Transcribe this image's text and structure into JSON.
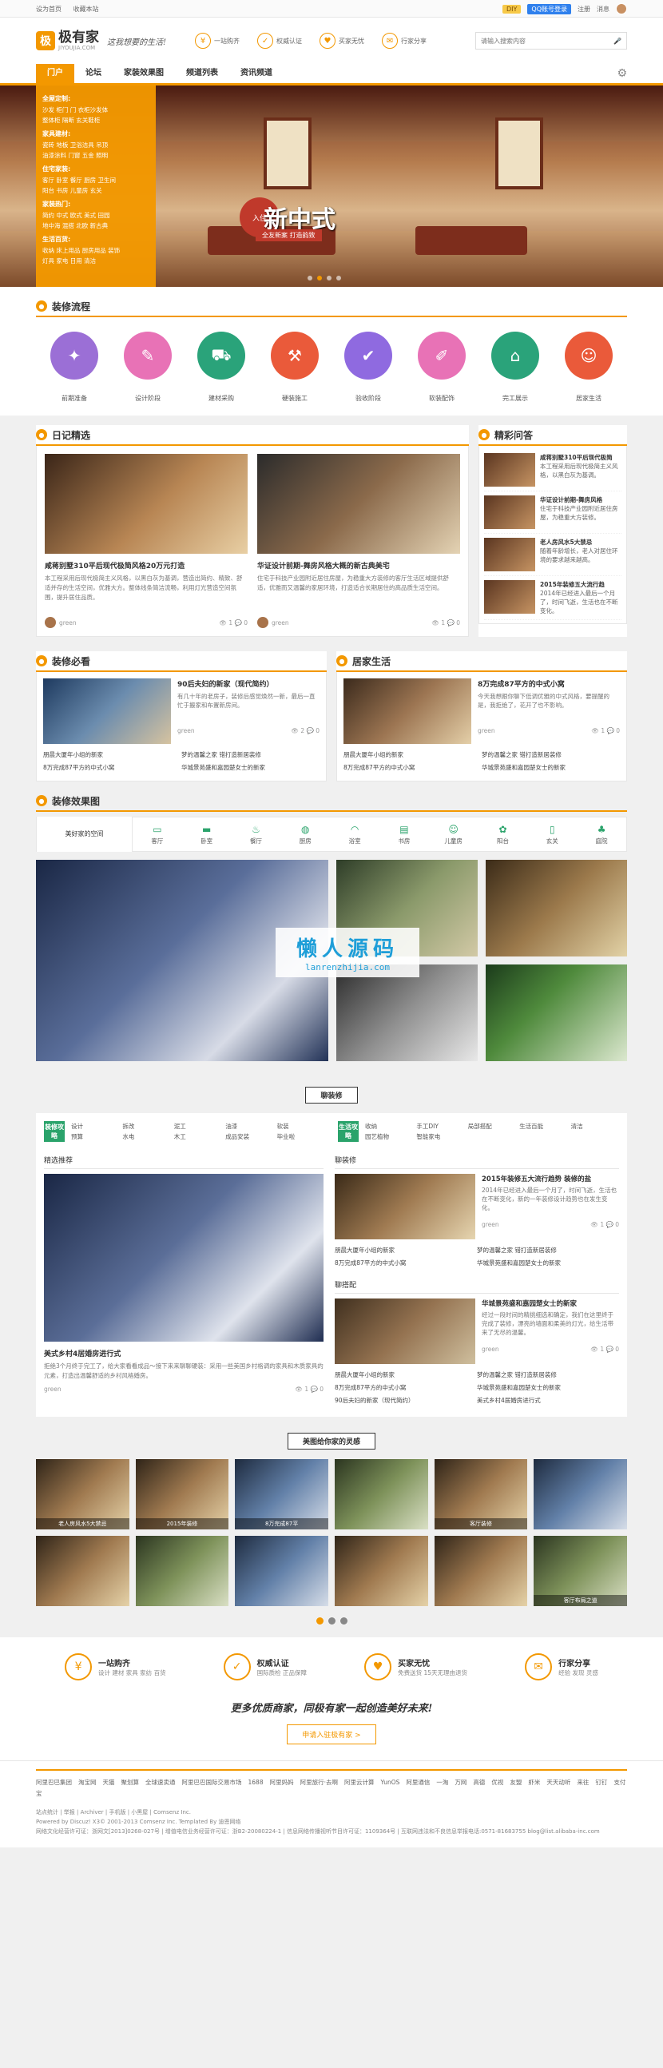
{
  "topbar": {
    "links": [
      "设为首页",
      "收藏本站"
    ],
    "diy": "DIY",
    "qq": "QQ账号登录",
    "register": "注册",
    "messages": "消息"
  },
  "header": {
    "logo_mark": "极",
    "logo_name": "极有家",
    "logo_sub": "JIYOUJIA.COM",
    "slogan": "这我想要的生活!",
    "features": [
      {
        "icon": "cart-icon",
        "glyph": "¥",
        "label": "一站购齐"
      },
      {
        "icon": "auth-icon",
        "glyph": "✓",
        "label": "权威认证"
      },
      {
        "icon": "worry-free-icon",
        "glyph": "♥",
        "label": "买家无忧"
      },
      {
        "icon": "share-icon",
        "glyph": "✉",
        "label": "行家分享"
      }
    ],
    "search_placeholder": "请输入搜索内容"
  },
  "nav": {
    "items": [
      "门户",
      "论坛",
      "家装效果图",
      "频道列表",
      "资讯频道"
    ]
  },
  "catmenu": {
    "groups": [
      {
        "title": "全屋定制:",
        "rows": [
          "沙发 柜门 门 衣柜沙发体",
          "整体柜 隔断 玄关鞋柜"
        ]
      },
      {
        "title": "家具建材:",
        "rows": [
          "瓷砖 地板 卫浴洁具 吊顶",
          "油漆涂料 门窗 五金 照明"
        ]
      },
      {
        "title": "住宅家装:",
        "rows": [
          "客厅 卧室 餐厅 厨房 卫生间",
          "阳台 书房 儿童房 玄关"
        ]
      },
      {
        "title": "家装热门:",
        "rows": [
          "简约 中式 欧式 美式 田园",
          "地中海 混搭 北欧 新古典"
        ]
      },
      {
        "title": "生活百货:",
        "rows": [
          "收纳 床上用品 厨房用品 装饰",
          "灯具 家电 日用 清洁"
        ]
      }
    ]
  },
  "banner": {
    "seal": "入住",
    "title": "新中式",
    "subtitle": "全友新案 打造韵致"
  },
  "flow": {
    "title": "装修流程",
    "steps": [
      {
        "label": "前期准备",
        "color": "#9b6fd6",
        "icon": "bulb-icon",
        "glyph": "✦"
      },
      {
        "label": "设计阶段",
        "color": "#e872b6",
        "icon": "pencil-icon",
        "glyph": "✎"
      },
      {
        "label": "建材采购",
        "color": "#2aa37a",
        "icon": "truck-icon",
        "glyph": "⛟"
      },
      {
        "label": "硬装施工",
        "color": "#ea5a3a",
        "icon": "hammer-icon",
        "glyph": "⚒"
      },
      {
        "label": "验收阶段",
        "color": "#8f6ae0",
        "icon": "check-icon",
        "glyph": "✔"
      },
      {
        "label": "软装配饰",
        "color": "#e872b6",
        "icon": "brush-icon",
        "glyph": "✐"
      },
      {
        "label": "完工展示",
        "color": "#2aa37a",
        "icon": "home-icon",
        "glyph": "⌂"
      },
      {
        "label": "居家生活",
        "color": "#ea5a3a",
        "icon": "smile-icon",
        "glyph": "☺"
      }
    ]
  },
  "diary": {
    "title": "日记精选",
    "cards": [
      {
        "title": "咸蒋别墅310平后现代极简风格20万元打造",
        "desc": "本工程采用后现代极简主义风格，以黑白灰为基调，营造出简约、精致、舒适并存的生活空间，优雅大方。整体线条简洁流畅，利用灯光营造空间氛围，提升居住品质。",
        "user": "green",
        "views": "1",
        "comments": "0"
      },
      {
        "title": "华证设计前期-舞房风格大概的新古典美宅",
        "desc": "住宅于科技产业园附近居住房屋，为稳重大方装修的客厅生活区域提供舒适，优雅而又温馨的家居环境，打造适合长期居住的高品质生活空间。",
        "user": "green",
        "views": "1",
        "comments": "0"
      }
    ]
  },
  "qa": {
    "title": "精彩问答",
    "items": [
      {
        "title": "咸蒋别墅310平后现代极简",
        "desc": "本工程采用后现代极简主义风格，以黑白灰为基调。"
      },
      {
        "title": "华证设计前期-舞房风格",
        "desc": "住宅于科技产业园附近居住房屋，为稳重大方装修。"
      },
      {
        "title": "老人房风水5大禁忌",
        "desc": "随着年龄增长，老人对居住环境的要求越来越高。"
      },
      {
        "title": "2015年装修五大流行趋",
        "desc": "2014年已经进入最后一个月了，时间飞逝，生活也在不断变化。"
      }
    ]
  },
  "must": {
    "title": "装修必看",
    "feature": {
      "title": "90后夫妇的新家（现代简约）",
      "desc": "有几十年的老房子，装修后感觉焕然一新，最后一直忙于搬家和布置新房间。",
      "user": "green",
      "views": "2",
      "comments": "0"
    },
    "links": [
      "朋晨大厦年小组的新家",
      "梦的温馨之家 错打造新居装修",
      "8万完成87平方的中式小窝",
      "华城景苑盛和嘉园楚女士的新家"
    ]
  },
  "life": {
    "title": "居家生活",
    "feature": {
      "title": "8万完成87平方的中式小窝",
      "desc": "今天我想跟你聊下低调优雅的中式风格，要提醒的是，我拒绝了，花开了也不影响。",
      "user": "green",
      "views": "1",
      "comments": "0"
    },
    "links": [
      "朋晨大厦年小组的新家",
      "梦的温馨之家 错打造新居装修",
      "8万完成87平方的中式小窝",
      "华城景苑盛和嘉园楚女士的新家"
    ]
  },
  "gallery": {
    "title": "装修效果图",
    "first_tab": "美好家的空间",
    "tabs": [
      {
        "label": "客厅",
        "icon": "tv-icon",
        "glyph": "▭"
      },
      {
        "label": "卧室",
        "icon": "bed-icon",
        "glyph": "▬"
      },
      {
        "label": "餐厅",
        "icon": "dining-icon",
        "glyph": "♨"
      },
      {
        "label": "厨房",
        "icon": "kitchen-icon",
        "glyph": "◍"
      },
      {
        "label": "浴室",
        "icon": "bath-icon",
        "glyph": "◠"
      },
      {
        "label": "书房",
        "icon": "book-icon",
        "glyph": "▤"
      },
      {
        "label": "儿童房",
        "icon": "kids-icon",
        "glyph": "☺"
      },
      {
        "label": "阳台",
        "icon": "balcony-icon",
        "glyph": "✿"
      },
      {
        "label": "玄关",
        "icon": "door-icon",
        "glyph": "▯"
      },
      {
        "label": "庭院",
        "icon": "tree-icon",
        "glyph": "♣"
      }
    ],
    "watermark_cn": "懒人源码",
    "watermark_en": "lanrenzhijia.com"
  },
  "liao": {
    "title": "聊装修",
    "cat1": {
      "label": "装修攻略",
      "items": [
        "设计",
        "拆改",
        "泥工",
        "油漆",
        "软装",
        "预算",
        "水电",
        "木工",
        "成品安装",
        "毕业啦"
      ]
    },
    "cat2": {
      "label": "生活攻略",
      "items": [
        "收纳",
        "手工DIY",
        "局部搭配",
        "生活百能",
        "清洁",
        "园艺植物",
        "智能家电",
        "",
        "",
        ""
      ]
    },
    "left_title": "精选推荐",
    "left_post": {
      "title": "美式乡村4居婚房进行式",
      "desc": "拒绝3个月终于完工了，给大家看看成品～接下来来聊聊硬装：采用一些美国乡村格调的家具和木质家具的元素，打造出温馨舒适的乡村风格婚房。",
      "user": "green",
      "views": "1",
      "comments": "0"
    },
    "right_title": "聊装修",
    "right_post": {
      "title": "2015年装修五大流行趋势 装修的盐",
      "desc": "2014年已经进入最后一个月了，时间飞逝，生活也在不断变化，新的一年装修设计趋势也在发生变化。",
      "user": "green",
      "views": "1",
      "comments": "0"
    },
    "right_links1": [
      "朋晨大厦年小组的新家",
      "梦的温馨之家 错打造新居装修",
      "8万完成87平方的中式小窝",
      "华城景苑盛和嘉园楚女士的新家"
    ],
    "right_title2": "聊搭配",
    "right_post2": {
      "title": "华城景苑盛和嘉园楚女士的新家",
      "desc": "经过一段时间的精挑细选和确定，我们在这里终于完成了装修，漂亮的墙面和柔美的灯光，给生活带来了无尽的温馨。",
      "user": "green",
      "views": "1",
      "comments": "0"
    },
    "right_links2": [
      "朋晨大厦年小组的新家",
      "梦的温馨之家 错打造新居装修",
      "8万完成87平方的中式小窝",
      "华城景苑盛和嘉园楚女士的新家",
      "90后夫妇的新家（现代简约）",
      "美式乡村4居婚房进行式"
    ]
  },
  "photos": {
    "title": "美图给你家的灵感",
    "captions": [
      "老人房风水5大禁忌",
      "2015年装修",
      "8万完成87平",
      "",
      "客厅装修",
      "",
      "",
      "",
      "",
      "",
      "",
      "客厅布局之道"
    ]
  },
  "services": [
    {
      "icon": "cart-icon",
      "glyph": "¥",
      "title": "一站购齐",
      "desc": "设计 建材 家具 家纺 百货"
    },
    {
      "icon": "auth-icon",
      "glyph": "✓",
      "title": "权威认证",
      "desc": "国际质检 正品保障"
    },
    {
      "icon": "worry-free-icon",
      "glyph": "♥",
      "title": "买家无忧",
      "desc": "免费送货 15天无理由退货"
    },
    {
      "icon": "share-icon",
      "glyph": "✉",
      "title": "行家分享",
      "desc": "经验 发现 灵感"
    }
  ],
  "cta": {
    "text": "更多优质商家，同极有家一起创造美好未来!",
    "button": "申请入驻极有家 >"
  },
  "footer": {
    "friends": [
      "阿里巴巴集团",
      "淘宝网",
      "天猫",
      "聚划算",
      "全球速卖通",
      "阿里巴巴国际交易市场",
      "1688",
      "阿里妈妈",
      "阿里旅行·去啊",
      "阿里云计算",
      "YunOS",
      "阿里通信",
      "一淘",
      "万网",
      "高德",
      "优视",
      "友盟",
      "虾米",
      "天天动听",
      "来往",
      "钉钉",
      "支付宝"
    ],
    "line1": "站点统计 | 举报 | Archiver | 手机版 | 小黑屋 | Comsenz Inc.",
    "line2": "Powered by Discuz! X3© 2001-2013 Comsenz Inc. Templated By 迪恩网络",
    "line3": "网络文化经营许可证：浙网文[2013]0268-027号 | 增值电信业务经营许可证：浙B2-20080224-1 | 信息网络传播视听节目许可证：1109364号 | 互联网违法和不良信息举报电话:0571-81683755 blog@list.alibaba-inc.com"
  }
}
